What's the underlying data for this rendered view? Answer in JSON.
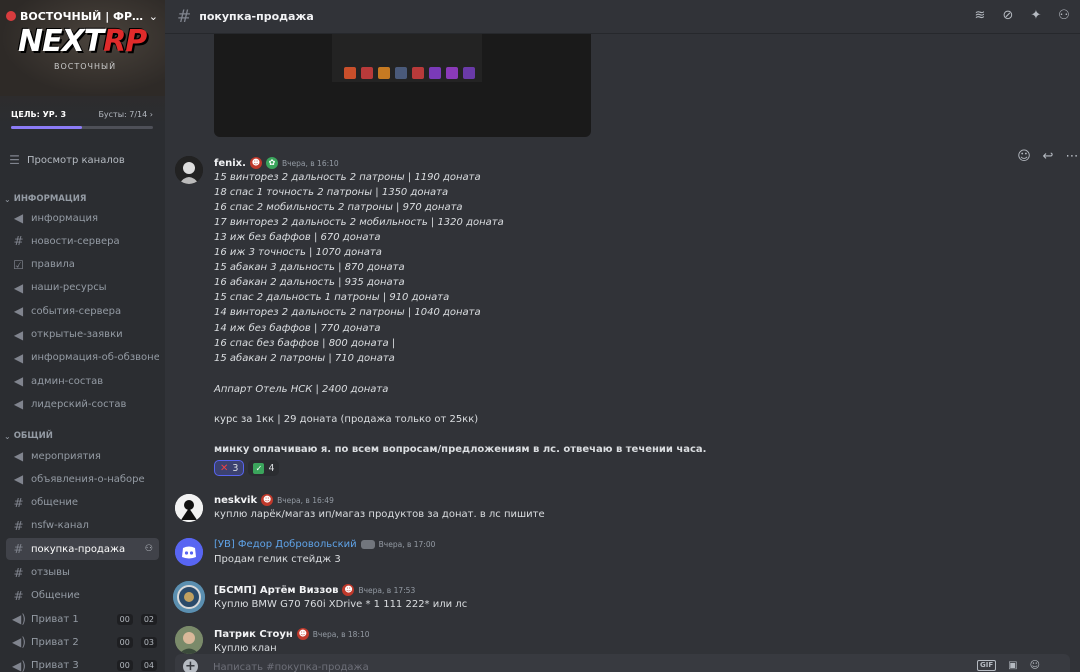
{
  "server": {
    "name": "ВОСТОЧНЫЙ | ФРА...",
    "logo_main": "NEXT",
    "logo_accent": "RP",
    "logo_sub": "ВОСТОЧНЫЙ",
    "goal_label": "ЦЕЛЬ: УР. 3",
    "boosts_label": "Бусты: 7/14",
    "boost_progress": 0.5
  },
  "sidebar": {
    "browse_label": "Просмотр каналов",
    "categories": [
      {
        "label": "ИНФОРМАЦИЯ"
      },
      {
        "label": "ОБЩИЙ"
      }
    ],
    "info_channels": [
      {
        "label": "информация",
        "icon": "megaphone-icon"
      },
      {
        "label": "новости-сервера",
        "icon": "hash-icon"
      },
      {
        "label": "правила",
        "icon": "rules-icon"
      },
      {
        "label": "наши-ресурсы",
        "icon": "megaphone-icon"
      },
      {
        "label": "события-сервера",
        "icon": "megaphone-icon"
      },
      {
        "label": "открытые-заявки",
        "icon": "megaphone-icon"
      },
      {
        "label": "информация-об-обзвоне",
        "icon": "megaphone-icon"
      },
      {
        "label": "админ-состав",
        "icon": "megaphone-icon"
      },
      {
        "label": "лидерский-состав",
        "icon": "megaphone-icon"
      }
    ],
    "general_channels": [
      {
        "label": "мероприятия",
        "icon": "megaphone-icon"
      },
      {
        "label": "объявления-о-наборе",
        "icon": "megaphone-icon"
      },
      {
        "label": "общение",
        "icon": "hash-icon"
      },
      {
        "label": "nsfw-канал",
        "icon": "hash-icon"
      },
      {
        "label": "покупка-продажа",
        "icon": "hash-icon"
      },
      {
        "label": "отзывы",
        "icon": "hash-icon"
      },
      {
        "label": "Общение",
        "icon": "hash-icon"
      },
      {
        "label": "Приват 1",
        "icon": "voice-icon",
        "badge1": "00",
        "badge2": "02"
      },
      {
        "label": "Приват 2",
        "icon": "voice-icon",
        "badge1": "00",
        "badge2": "03"
      },
      {
        "label": "Приват 3",
        "icon": "voice-icon",
        "badge1": "00",
        "badge2": "04"
      }
    ]
  },
  "topbar": {
    "channel_name": "покупка-продажа"
  },
  "messages": {
    "fenix": {
      "author": "fenix.",
      "time": "Вчера, в 16:10",
      "lines": [
        "15 винторез 2 дальность 2 патроны | 1190 доната",
        "18 спас 1 точность 2 патроны | 1350 доната",
        "16 спас 2 мобильность 2 патроны | 970 доната",
        "17 винторез 2 дальность 2 мобильность | 1320 доната",
        "13 иж без баффов | 670 доната",
        "16 иж 3 точность | 1070 доната",
        "15 абакан 3 дальность | 870 доната",
        "16 абакан 2 дальность | 935 доната",
        "15 спас 2 дальность 1 патроны | 910 доната",
        "14 винторез 2 дальность 2 патроны | 1040 доната",
        "14 иж без баффов | 770 доната",
        "16 спас без баффов | 800 доната |",
        "15 абакан 2 патроны | 710 доната"
      ],
      "apartment": "Аппарт Отель НСК | 2400 доната",
      "rate": "курс за 1кк | 29 доната (продажа только от 25кк)",
      "note": "минку оплачиваю я.  по всем вопросам/предложениям в лс. отвечаю в течении часа.",
      "reactions": [
        {
          "emoji": "✕",
          "count": "3"
        },
        {
          "emoji": "✓",
          "count": "4"
        }
      ]
    },
    "neskvik": {
      "author": "neskvik",
      "time": "Вчера, в 16:49",
      "text": "куплю ларёк/магаз ип/магаз продуктов за донат. в лс пишите"
    },
    "fedor": {
      "author": "[УВ] Федор Добровольский",
      "time": "Вчера, в 17:00",
      "text": "Продам гелик стейдж 3"
    },
    "artem": {
      "author": "[БСМП] Артём Виззов",
      "time": "Вчера, в 17:53",
      "text": "Куплю BMW G70 760i XDrive * 1 111 222* или лс"
    },
    "patrik": {
      "author": "Патрик Стоун",
      "time": "Вчера, в 18:10",
      "text": "Куплю клан"
    }
  },
  "composer": {
    "placeholder": "Написать #покупка-продажа",
    "gif_label": "GIF"
  },
  "colors": {
    "accent": "#5865f2",
    "boost_bar": "#8c7cf7",
    "brand_red": "#e02b2b"
  }
}
